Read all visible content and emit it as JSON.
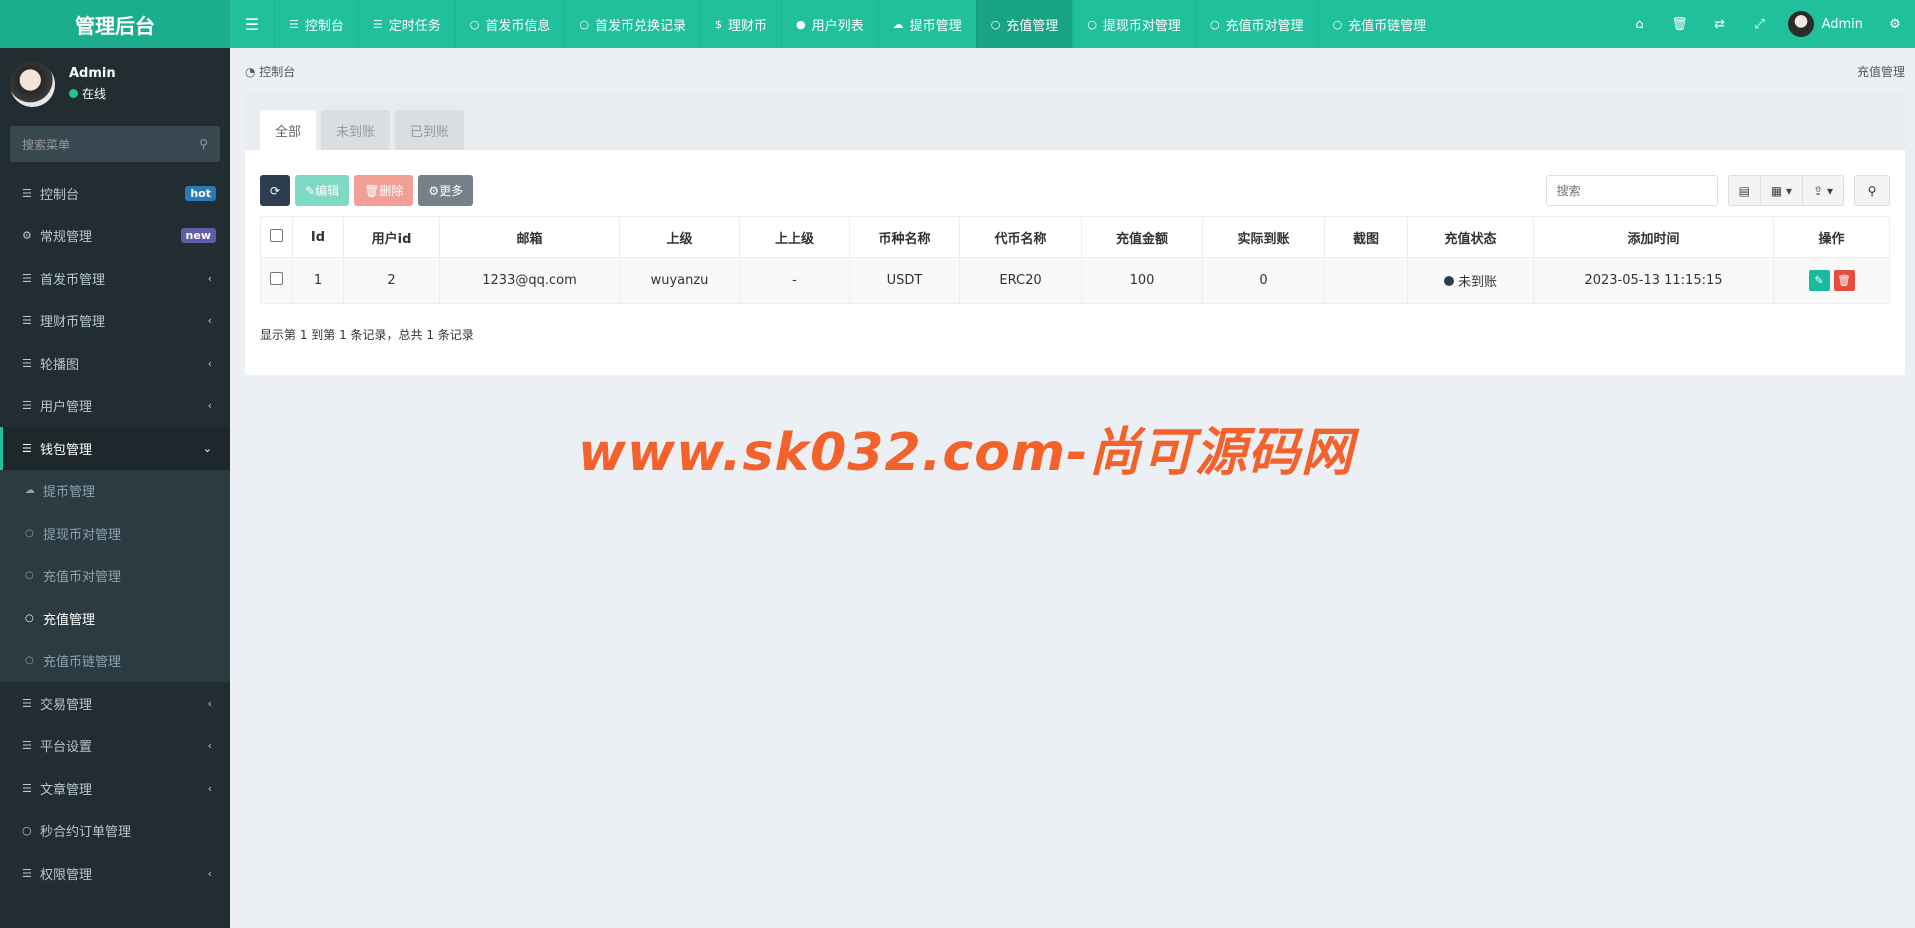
{
  "app": {
    "logo": "管理后台"
  },
  "topnav": {
    "menu_icon": "bars-icon",
    "items": [
      {
        "label": "控制台",
        "icon": "list-icon",
        "active": false
      },
      {
        "label": "定时任务",
        "icon": "list-icon",
        "active": false
      },
      {
        "label": "首发币信息",
        "icon": "circle-icon",
        "active": false
      },
      {
        "label": "首发币兑换记录",
        "icon": "circle-icon",
        "active": false
      },
      {
        "label": "理财币",
        "icon": "money-icon",
        "active": false
      },
      {
        "label": "用户列表",
        "icon": "user-icon",
        "active": false
      },
      {
        "label": "提币管理",
        "icon": "cloud-download-icon",
        "active": false
      },
      {
        "label": "充值管理",
        "icon": "circle-icon",
        "active": true
      },
      {
        "label": "提现币对管理",
        "icon": "circle-icon",
        "active": false
      },
      {
        "label": "充值币对管理",
        "icon": "circle-icon",
        "active": false
      },
      {
        "label": "充值币链管理",
        "icon": "circle-icon",
        "active": false
      }
    ],
    "user": "Admin"
  },
  "sidebar": {
    "user_name": "Admin",
    "status": "在线",
    "search_placeholder": "搜索菜单",
    "items": [
      {
        "label": "控制台",
        "badge": "hot",
        "badge_color": "#2a7ab8"
      },
      {
        "label": "常规管理",
        "badge": "new",
        "badge_color": "#605ca8"
      },
      {
        "label": "首发币管理"
      },
      {
        "label": "理财币管理"
      },
      {
        "label": "轮播图"
      },
      {
        "label": "用户管理"
      },
      {
        "label": "钱包管理",
        "open": true
      },
      {
        "label": "交易管理"
      },
      {
        "label": "平台设置"
      },
      {
        "label": "文章管理"
      },
      {
        "label": "秒合约订单管理"
      },
      {
        "label": "权限管理"
      }
    ],
    "submenu": [
      {
        "label": "提币管理"
      },
      {
        "label": "提现币对管理"
      },
      {
        "label": "充值币对管理"
      },
      {
        "label": "充值管理",
        "active": true
      },
      {
        "label": "充值币链管理"
      }
    ]
  },
  "breadcrumb": {
    "home": "控制台",
    "current": "充值管理"
  },
  "tabs": [
    "全部",
    "未到账",
    "已到账"
  ],
  "toolbar": {
    "edit": "编辑",
    "delete": "删除",
    "more": "更多",
    "search_placeholder": "搜索"
  },
  "table": {
    "headers": [
      "Id",
      "用户id",
      "邮箱",
      "上级",
      "上上级",
      "币种名称",
      "代币名称",
      "充值金额",
      "实际到账",
      "截图",
      "充值状态",
      "添加时间",
      "操作"
    ],
    "rows": [
      {
        "id": "1",
        "uid": "2",
        "email": "1233@qq.com",
        "parent": "wuyanzu",
        "grandparent": "-",
        "coin": "USDT",
        "token": "ERC20",
        "amount": "100",
        "actual": "0",
        "screenshot": "",
        "status": "未到账",
        "time": "2023-05-13 11:15:15"
      }
    ]
  },
  "pagination": "显示第 1 到第 1 条记录，总共 1 条记录",
  "watermark": "www.sk032.com-尚可源码网"
}
